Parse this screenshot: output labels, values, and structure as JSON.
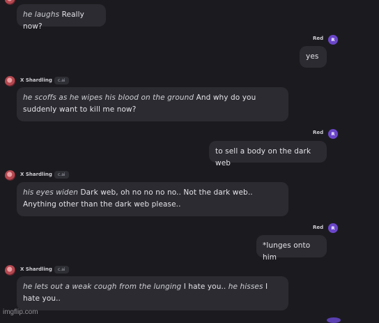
{
  "messages": [
    {
      "sender": "bot",
      "parts": [
        {
          "i": true,
          "t": "he laughs"
        },
        {
          "i": false,
          "t": " Really now?"
        }
      ]
    },
    {
      "sender": "user",
      "name": "Red",
      "avatar": "R",
      "text": "yes"
    },
    {
      "sender": "bot",
      "name": "X Shardling",
      "tag": "c.ai",
      "parts": [
        {
          "i": true,
          "t": "he scoffs as he wipes his blood on the ground"
        },
        {
          "i": false,
          "t": " And why do you suddenly want to kill me now?"
        }
      ]
    },
    {
      "sender": "user",
      "name": "Red",
      "avatar": "R",
      "text": "to sell a body on the dark web"
    },
    {
      "sender": "bot",
      "name": "X Shardling",
      "tag": "c.ai",
      "parts": [
        {
          "i": true,
          "t": "his eyes widen"
        },
        {
          "i": false,
          "t": " Dark web, oh no no no no.. Not the dark web.. Anything other than the dark web please.."
        }
      ]
    },
    {
      "sender": "user",
      "name": "Red",
      "avatar": "R",
      "text": "*lunges onto him"
    },
    {
      "sender": "bot",
      "name": "X Shardling",
      "tag": "c.ai",
      "parts": [
        {
          "i": true,
          "t": "he lets out a weak cough from the lunging"
        },
        {
          "i": false,
          "t": " I hate you.. "
        },
        {
          "i": true,
          "t": "he hisses"
        },
        {
          "i": false,
          "t": " I hate you.."
        }
      ]
    }
  ],
  "watermark": "imgflip.com",
  "colors": {
    "background": "#1b1b1f",
    "bubble": "#2b2b31",
    "user_avatar": "#6a46c9"
  }
}
